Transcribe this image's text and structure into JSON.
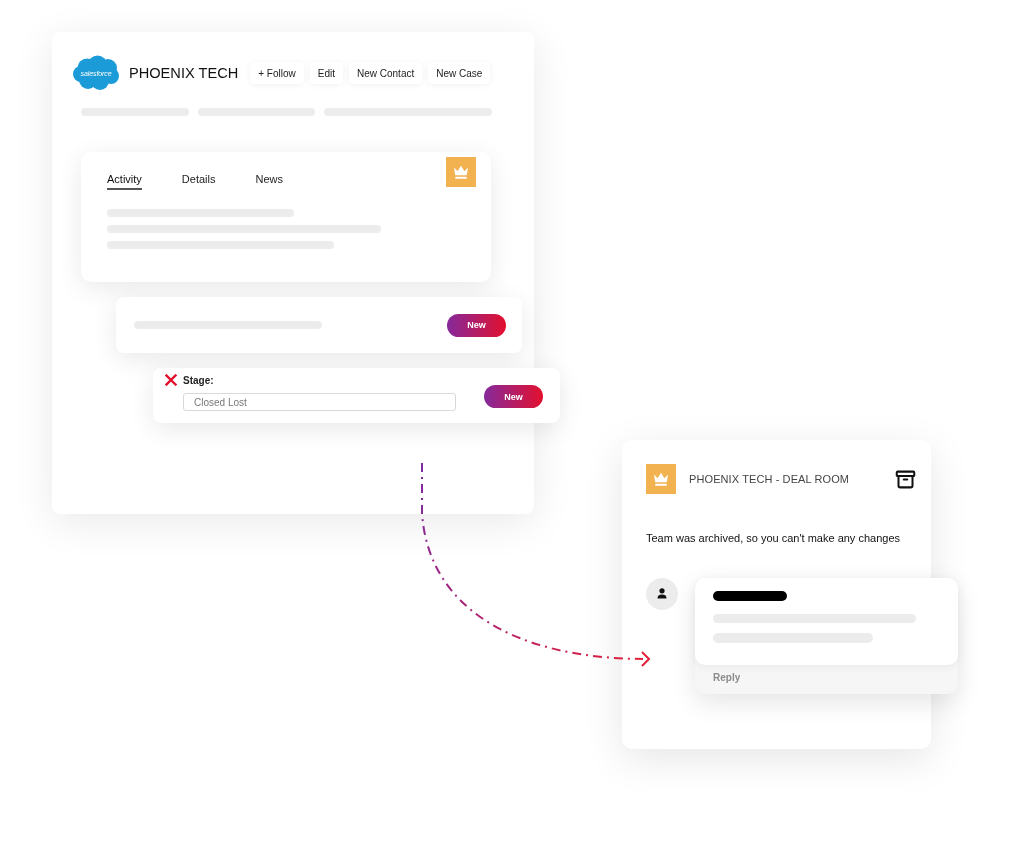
{
  "crm_window": {
    "logo_text": "salesforce",
    "title": "PHOENIX TECH",
    "actions": [
      "+ Follow",
      "Edit",
      "New Contact",
      "New Case"
    ],
    "activity_card": {
      "tabs": [
        {
          "label": "Activity",
          "selected": true
        },
        {
          "label": "Details",
          "selected": false
        },
        {
          "label": "News",
          "selected": false
        }
      ]
    },
    "new_card": {
      "button": "New"
    },
    "stage_card": {
      "invalid": true,
      "label": "Stage:",
      "value": "Closed Lost",
      "button": "New"
    }
  },
  "deal_room": {
    "title": "PHOENIX TECH - DEAL ROOM",
    "message": "Team was archived, so you can't make any changes",
    "comment": {
      "reply": "Reply"
    }
  }
}
